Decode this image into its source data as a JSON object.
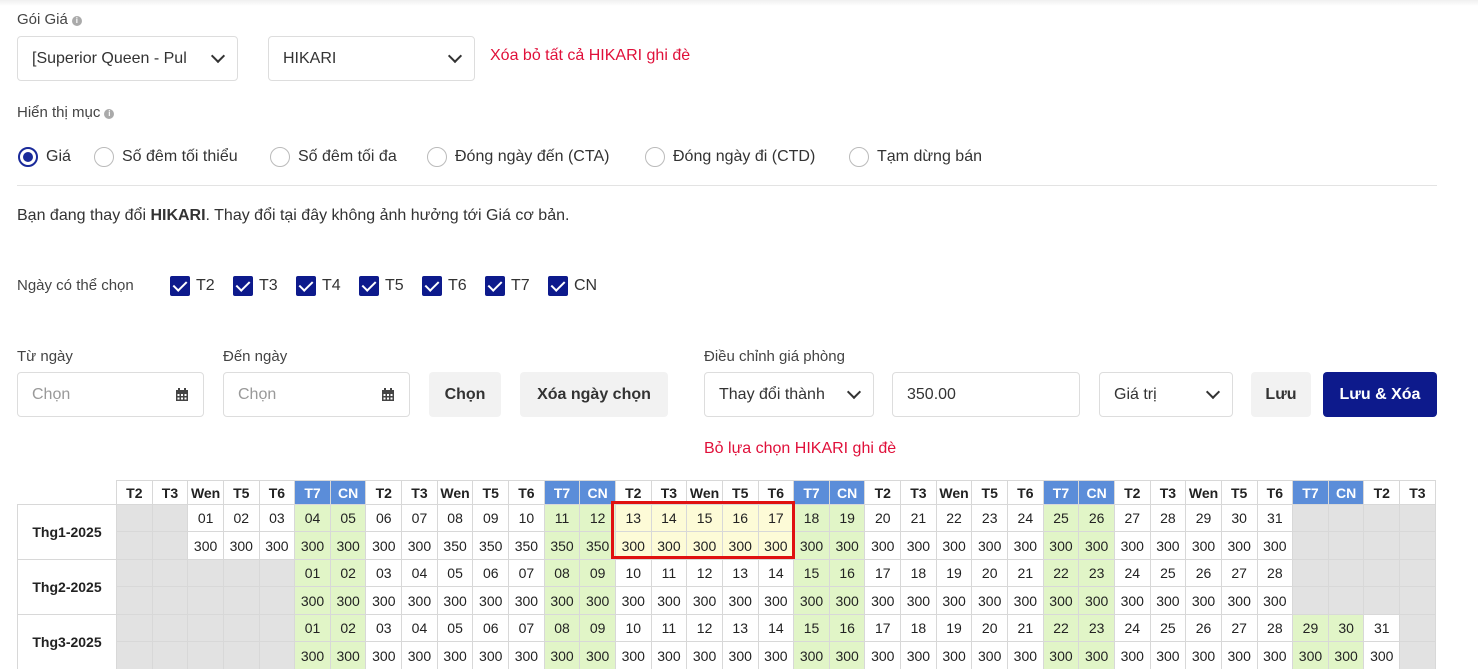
{
  "rate_plan": {
    "label": "Gói Giá",
    "room_select": "[Superior Queen - Pul",
    "channel_select": "HIKARI",
    "clear_all_override": "Xóa bỏ tất cả HIKARI ghi đè"
  },
  "display": {
    "label": "Hiển thị mục",
    "options": [
      "Giá",
      "Số đêm tối thiểu",
      "Số đêm tối đa",
      "Đóng ngày đến (CTA)",
      "Đóng ngày đi (CTD)",
      "Tạm dừng bán"
    ],
    "selected": "Giá"
  },
  "notice": {
    "prefix": "Bạn đang thay đổi ",
    "bold": "HIKARI",
    "suffix": ". Thay đổi tại đây không ảnh hưởng tới Giá cơ bản."
  },
  "days": {
    "label": "Ngày có thể chọn",
    "items": [
      "T2",
      "T3",
      "T4",
      "T5",
      "T6",
      "T7",
      "CN"
    ]
  },
  "range": {
    "from_label": "Từ ngày",
    "to_label": "Đến ngày",
    "from_placeholder": "Chọn",
    "to_placeholder": "Chọn",
    "choose_button": "Chọn",
    "clear_button": "Xóa ngày chọn"
  },
  "adjust": {
    "label": "Điều chỉnh giá phòng",
    "mode": "Thay đổi thành",
    "amount": "350.00",
    "type": "Giá trị",
    "save": "Lưu",
    "save_clear": "Lưu & Xóa",
    "deselect": "Bỏ lựa chọn HIKARI ghi đè"
  },
  "calendar": {
    "headers": [
      "T2",
      "T3",
      "Wen",
      "T5",
      "T6",
      "T7",
      "CN",
      "T2",
      "T3",
      "Wen",
      "T5",
      "T6",
      "T7",
      "CN",
      "T2",
      "T3",
      "Wen",
      "T5",
      "T6",
      "T7",
      "CN",
      "T2",
      "T3",
      "Wen",
      "T5",
      "T6",
      "T7",
      "CN",
      "T2",
      "T3",
      "Wen",
      "T5",
      "T6",
      "T7",
      "CN",
      "T2",
      "T3"
    ],
    "months": [
      {
        "name": "Thg1-2025",
        "offset": 2,
        "days": 31,
        "prices": [
          "300",
          "300",
          "300",
          "300",
          "300",
          "300",
          "300",
          "350",
          "350",
          "350",
          "350",
          "350",
          "300",
          "300",
          "300",
          "300",
          "300",
          "300",
          "300",
          "300",
          "300",
          "300",
          "300",
          "300",
          "300",
          "300",
          "300",
          "300",
          "300",
          "300",
          "300"
        ]
      },
      {
        "name": "Thg2-2025",
        "offset": 5,
        "days": 28,
        "prices": [
          "300",
          "300",
          "300",
          "300",
          "300",
          "300",
          "300",
          "300",
          "300",
          "300",
          "300",
          "300",
          "300",
          "300",
          "300",
          "300",
          "300",
          "300",
          "300",
          "300",
          "300",
          "300",
          "300",
          "300",
          "300",
          "300",
          "300",
          "300"
        ]
      },
      {
        "name": "Thg3-2025",
        "offset": 5,
        "days": 31,
        "prices": [
          "300",
          "300",
          "300",
          "300",
          "300",
          "300",
          "300",
          "300",
          "300",
          "300",
          "300",
          "300",
          "300",
          "300",
          "300",
          "300",
          "300",
          "300",
          "300",
          "300",
          "300",
          "300",
          "300",
          "300",
          "300",
          "300",
          "300",
          "300",
          "300",
          "300",
          "300"
        ]
      }
    ]
  }
}
